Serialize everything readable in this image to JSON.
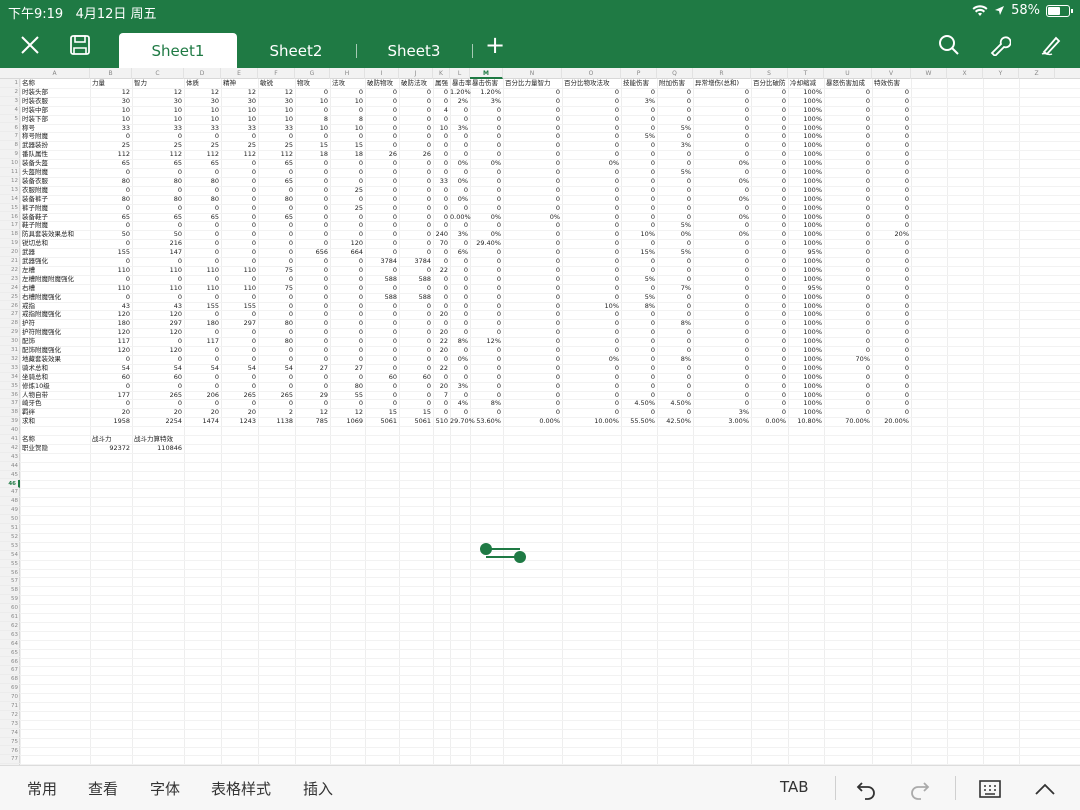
{
  "status": {
    "time": "下午9:19",
    "date": "4月12日 周五",
    "battery": "58%"
  },
  "tabs": [
    {
      "label": "Sheet1",
      "active": true
    },
    {
      "label": "Sheet2",
      "active": false
    },
    {
      "label": "Sheet3",
      "active": false
    }
  ],
  "add_tab": "+",
  "columns": [
    "A",
    "B",
    "C",
    "D",
    "E",
    "F",
    "G",
    "H",
    "I",
    "J",
    "K",
    "L",
    "M",
    "N",
    "O",
    "P",
    "Q",
    "R",
    "S",
    "T",
    "U",
    "V",
    "W",
    "X",
    "Y",
    "Z"
  ],
  "selected_column": "M",
  "selected_row": "46",
  "row_count": 77,
  "rows": [
    [
      "名称",
      "力量",
      "智力",
      "体质",
      "精神",
      "敏锐",
      "物攻",
      "法攻",
      "破防物攻",
      "破防法攻",
      "属强",
      "暴击率",
      "暴击伤害",
      "百分比力量智力",
      "百分比物攻法攻",
      "技能伤害",
      "附加伤害",
      "异常增伤(总和)",
      "百分比破防",
      "冷却缩减",
      "暴怒伤害加成",
      "特效伤害"
    ],
    [
      "时装头部",
      "12",
      "12",
      "12",
      "12",
      "12",
      "0",
      "0",
      "0",
      "0",
      "0",
      "1.20%",
      "1.20%",
      "0",
      "0",
      "0",
      "0",
      "0",
      "0",
      "100%",
      "0",
      "0"
    ],
    [
      "时装衣服",
      "30",
      "30",
      "30",
      "30",
      "30",
      "10",
      "10",
      "0",
      "0",
      "0",
      "2%",
      "3%",
      "0",
      "0",
      "3%",
      "0",
      "0",
      "0",
      "100%",
      "0",
      "0"
    ],
    [
      "时装中部",
      "10",
      "10",
      "10",
      "10",
      "10",
      "0",
      "0",
      "0",
      "0",
      "4",
      "0",
      "0",
      "0",
      "0",
      "0",
      "0",
      "0",
      "0",
      "100%",
      "0",
      "0"
    ],
    [
      "时装下部",
      "10",
      "10",
      "10",
      "10",
      "10",
      "8",
      "8",
      "0",
      "0",
      "0",
      "0",
      "0",
      "0",
      "0",
      "0",
      "0",
      "0",
      "0",
      "100%",
      "0",
      "0"
    ],
    [
      "称号",
      "33",
      "33",
      "33",
      "33",
      "33",
      "10",
      "10",
      "0",
      "0",
      "10",
      "3%",
      "0",
      "0",
      "0",
      "0",
      "5%",
      "0",
      "0",
      "100%",
      "0",
      "0"
    ],
    [
      "称号附魔",
      "0",
      "0",
      "0",
      "0",
      "0",
      "0",
      "0",
      "0",
      "0",
      "0",
      "0",
      "0",
      "0",
      "0",
      "5%",
      "0",
      "0",
      "0",
      "100%",
      "0",
      "0"
    ],
    [
      "武器装扮",
      "25",
      "25",
      "25",
      "25",
      "25",
      "15",
      "15",
      "0",
      "0",
      "0",
      "0",
      "0",
      "0",
      "0",
      "0",
      "3%",
      "0",
      "0",
      "100%",
      "0",
      "0"
    ],
    [
      "番队属性",
      "112",
      "112",
      "112",
      "112",
      "112",
      "18",
      "18",
      "26",
      "26",
      "0",
      "0",
      "0",
      "0",
      "0",
      "0",
      "0",
      "0",
      "0",
      "100%",
      "0",
      "0"
    ],
    [
      "装备头盔",
      "65",
      "65",
      "65",
      "0",
      "65",
      "0",
      "0",
      "0",
      "0",
      "0",
      "0%",
      "0%",
      "0",
      "0%",
      "0",
      "0",
      "0%",
      "0",
      "100%",
      "0",
      "0"
    ],
    [
      "头盔附魔",
      "0",
      "0",
      "0",
      "0",
      "0",
      "0",
      "0",
      "0",
      "0",
      "0",
      "0",
      "0",
      "0",
      "0",
      "0",
      "5%",
      "0",
      "0",
      "100%",
      "0",
      "0"
    ],
    [
      "装备衣服",
      "80",
      "80",
      "80",
      "0",
      "65",
      "0",
      "0",
      "0",
      "0",
      "33",
      "0%",
      "0",
      "0",
      "0",
      "0",
      "0",
      "0%",
      "0",
      "100%",
      "0",
      "0"
    ],
    [
      "衣服附魔",
      "0",
      "0",
      "0",
      "0",
      "0",
      "0",
      "25",
      "0",
      "0",
      "0",
      "0",
      "0",
      "0",
      "0",
      "0",
      "0",
      "0",
      "0",
      "100%",
      "0",
      "0"
    ],
    [
      "装备裤子",
      "80",
      "80",
      "80",
      "0",
      "80",
      "0",
      "0",
      "0",
      "0",
      "0",
      "0%",
      "0",
      "0",
      "0",
      "0",
      "0",
      "0%",
      "0",
      "100%",
      "0",
      "0"
    ],
    [
      "裤子附魔",
      "0",
      "0",
      "0",
      "0",
      "0",
      "0",
      "25",
      "0",
      "0",
      "0",
      "0",
      "0",
      "0",
      "0",
      "0",
      "0",
      "0",
      "0",
      "100%",
      "0",
      "0"
    ],
    [
      "装备鞋子",
      "65",
      "65",
      "65",
      "0",
      "65",
      "0",
      "0",
      "0",
      "0",
      "0",
      "0.00%",
      "0%",
      "0%",
      "0",
      "0",
      "0",
      "0%",
      "0",
      "100%",
      "0",
      "0"
    ],
    [
      "鞋子附魔",
      "0",
      "0",
      "0",
      "0",
      "0",
      "0",
      "0",
      "0",
      "0",
      "0",
      "0",
      "0",
      "0",
      "0",
      "0",
      "5%",
      "0",
      "0",
      "100%",
      "0",
      "0"
    ],
    [
      "防具套装效果总和",
      "50",
      "50",
      "0",
      "0",
      "0",
      "0",
      "0",
      "0",
      "0",
      "240",
      "3%",
      "0%",
      "0",
      "0",
      "10%",
      "0%",
      "0%",
      "0",
      "100%",
      "0",
      "20%"
    ],
    [
      "锐切总和",
      "0",
      "216",
      "0",
      "0",
      "0",
      "0",
      "120",
      "0",
      "0",
      "70",
      "0",
      "29.40%",
      "0",
      "0",
      "0",
      "0",
      "0",
      "0",
      "100%",
      "0",
      "0"
    ],
    [
      "武器",
      "155",
      "147",
      "0",
      "0",
      "0",
      "656",
      "664",
      "0",
      "0",
      "0",
      "6%",
      "0",
      "0",
      "0",
      "15%",
      "5%",
      "0",
      "0",
      "95%",
      "0",
      "0"
    ],
    [
      "武器强化",
      "0",
      "0",
      "0",
      "0",
      "0",
      "0",
      "0",
      "3784",
      "3784",
      "0",
      "0",
      "0",
      "0",
      "0",
      "0",
      "0",
      "0",
      "0",
      "100%",
      "0",
      "0"
    ],
    [
      "左槽",
      "110",
      "110",
      "110",
      "110",
      "75",
      "0",
      "0",
      "0",
      "0",
      "22",
      "0",
      "0",
      "0",
      "0",
      "0",
      "0",
      "0",
      "0",
      "100%",
      "0",
      "0"
    ],
    [
      "左槽附魔附魔强化",
      "0",
      "0",
      "0",
      "0",
      "0",
      "0",
      "0",
      "588",
      "588",
      "0",
      "0",
      "0",
      "0",
      "0",
      "5%",
      "0",
      "0",
      "0",
      "100%",
      "0",
      "0"
    ],
    [
      "右槽",
      "110",
      "110",
      "110",
      "110",
      "75",
      "0",
      "0",
      "0",
      "0",
      "0",
      "0",
      "0",
      "0",
      "0",
      "0",
      "7%",
      "0",
      "0",
      "95%",
      "0",
      "0"
    ],
    [
      "右槽附魔强化",
      "0",
      "0",
      "0",
      "0",
      "0",
      "0",
      "0",
      "588",
      "588",
      "0",
      "0",
      "0",
      "0",
      "0",
      "5%",
      "0",
      "0",
      "0",
      "100%",
      "0",
      "0"
    ],
    [
      "戒指",
      "43",
      "43",
      "155",
      "155",
      "0",
      "0",
      "0",
      "0",
      "0",
      "0",
      "0",
      "0",
      "0",
      "10%",
      "8%",
      "0",
      "0",
      "0",
      "100%",
      "0",
      "0"
    ],
    [
      "戒指附魔强化",
      "120",
      "120",
      "0",
      "0",
      "0",
      "0",
      "0",
      "0",
      "0",
      "20",
      "0",
      "0",
      "0",
      "0",
      "0",
      "0",
      "0",
      "0",
      "100%",
      "0",
      "0"
    ],
    [
      "护符",
      "180",
      "297",
      "180",
      "297",
      "80",
      "0",
      "0",
      "0",
      "0",
      "0",
      "0",
      "0",
      "0",
      "0",
      "0",
      "8%",
      "0",
      "0",
      "100%",
      "0",
      "0"
    ],
    [
      "护符附魔强化",
      "120",
      "120",
      "0",
      "0",
      "0",
      "0",
      "0",
      "0",
      "0",
      "20",
      "0",
      "0",
      "0",
      "0",
      "0",
      "0",
      "0",
      "0",
      "100%",
      "0",
      "0"
    ],
    [
      "配饰",
      "117",
      "0",
      "117",
      "0",
      "80",
      "0",
      "0",
      "0",
      "0",
      "22",
      "8%",
      "12%",
      "0",
      "0",
      "0",
      "0",
      "0",
      "0",
      "100%",
      "0",
      "0"
    ],
    [
      "配饰附魔强化",
      "120",
      "120",
      "0",
      "0",
      "0",
      "0",
      "0",
      "0",
      "0",
      "20",
      "0",
      "0",
      "0",
      "0",
      "0",
      "0",
      "0",
      "0",
      "100%",
      "0",
      "0"
    ],
    [
      "地藏套装效果",
      "0",
      "0",
      "0",
      "0",
      "0",
      "0",
      "0",
      "0",
      "0",
      "0",
      "0%",
      "0",
      "0",
      "0%",
      "0",
      "8%",
      "0",
      "0",
      "100%",
      "70%",
      "0"
    ],
    [
      "骑术总和",
      "54",
      "54",
      "54",
      "54",
      "54",
      "27",
      "27",
      "0",
      "0",
      "22",
      "0",
      "0",
      "0",
      "0",
      "0",
      "0",
      "0",
      "0",
      "100%",
      "0",
      "0"
    ],
    [
      "坐骑总和",
      "60",
      "60",
      "0",
      "0",
      "0",
      "0",
      "0",
      "60",
      "60",
      "0",
      "0",
      "0",
      "0",
      "0",
      "0",
      "0",
      "0",
      "0",
      "100%",
      "0",
      "0"
    ],
    [
      "修炼10级",
      "0",
      "0",
      "0",
      "0",
      "0",
      "0",
      "80",
      "0",
      "0",
      "20",
      "3%",
      "0",
      "0",
      "0",
      "0",
      "0",
      "0",
      "0",
      "100%",
      "0",
      "0"
    ],
    [
      "人物自带",
      "177",
      "265",
      "206",
      "265",
      "265",
      "29",
      "55",
      "0",
      "0",
      "7",
      "0",
      "0",
      "0",
      "0",
      "0",
      "0",
      "0",
      "0",
      "100%",
      "0",
      "0"
    ],
    [
      "崎牙色",
      "0",
      "0",
      "0",
      "0",
      "0",
      "0",
      "0",
      "0",
      "0",
      "0",
      "4%",
      "8%",
      "0",
      "0",
      "4.50%",
      "4.50%",
      "0",
      "0",
      "100%",
      "0",
      "0"
    ],
    [
      "羁绊",
      "20",
      "20",
      "20",
      "20",
      "2",
      "12",
      "12",
      "15",
      "15",
      "0",
      "0",
      "0",
      "0",
      "0",
      "0",
      "0",
      "3%",
      "0",
      "100%",
      "0",
      "0"
    ],
    [
      "求和",
      "1958",
      "2254",
      "1474",
      "1243",
      "1138",
      "785",
      "1069",
      "5061",
      "5061",
      "510",
      "29.70%",
      "53.60%",
      "0.00%",
      "10.00%",
      "55.50%",
      "42.50%",
      "3.00%",
      "0.00%",
      "10.80%",
      "70.00%",
      "20.00%"
    ]
  ],
  "summary": [
    [
      "名称",
      "战斗力",
      "战斗力算特效"
    ],
    [
      "职业贺隐",
      "92372",
      "110846"
    ]
  ],
  "bottom": {
    "menu": [
      "常用",
      "查看",
      "字体",
      "表格样式",
      "插入"
    ],
    "tab_key": "TAB"
  },
  "colors": {
    "brand": "#1f7a44"
  }
}
